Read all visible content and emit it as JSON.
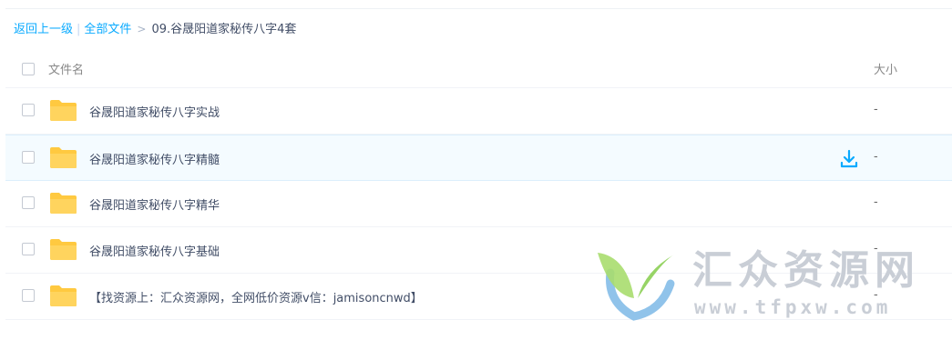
{
  "breadcrumb": {
    "back": "返回上一级",
    "separator": "|",
    "all_files": "全部文件",
    "chevron": ">",
    "current": "09.谷晟阳道家秘传八字4套"
  },
  "table": {
    "header": {
      "name": "文件名",
      "size": "大小"
    },
    "rows": [
      {
        "name": "谷晟阳道家秘传八字实战",
        "size": "-"
      },
      {
        "name": "谷晟阳道家秘传八字精髓",
        "size": "-"
      },
      {
        "name": "谷晟阳道家秘传八字精华",
        "size": "-"
      },
      {
        "name": "谷晟阳道家秘传八字基础",
        "size": "-"
      },
      {
        "name": "【找资源上：汇众资源网，全网低价资源v信：jamisoncnwd】",
        "size": "-"
      }
    ]
  },
  "watermark": {
    "title": "汇众资源网",
    "url": "www.tfpxw.com"
  },
  "colors": {
    "link": "#09aaff",
    "folder": "#ffd45e",
    "hover_row": "#f4fbff",
    "watermark_green": "#9fd86a",
    "watermark_blue": "#6ab0e6"
  },
  "icons": {
    "folder": "folder-icon",
    "download": "download-icon",
    "logo": "leaf-logo-icon"
  }
}
